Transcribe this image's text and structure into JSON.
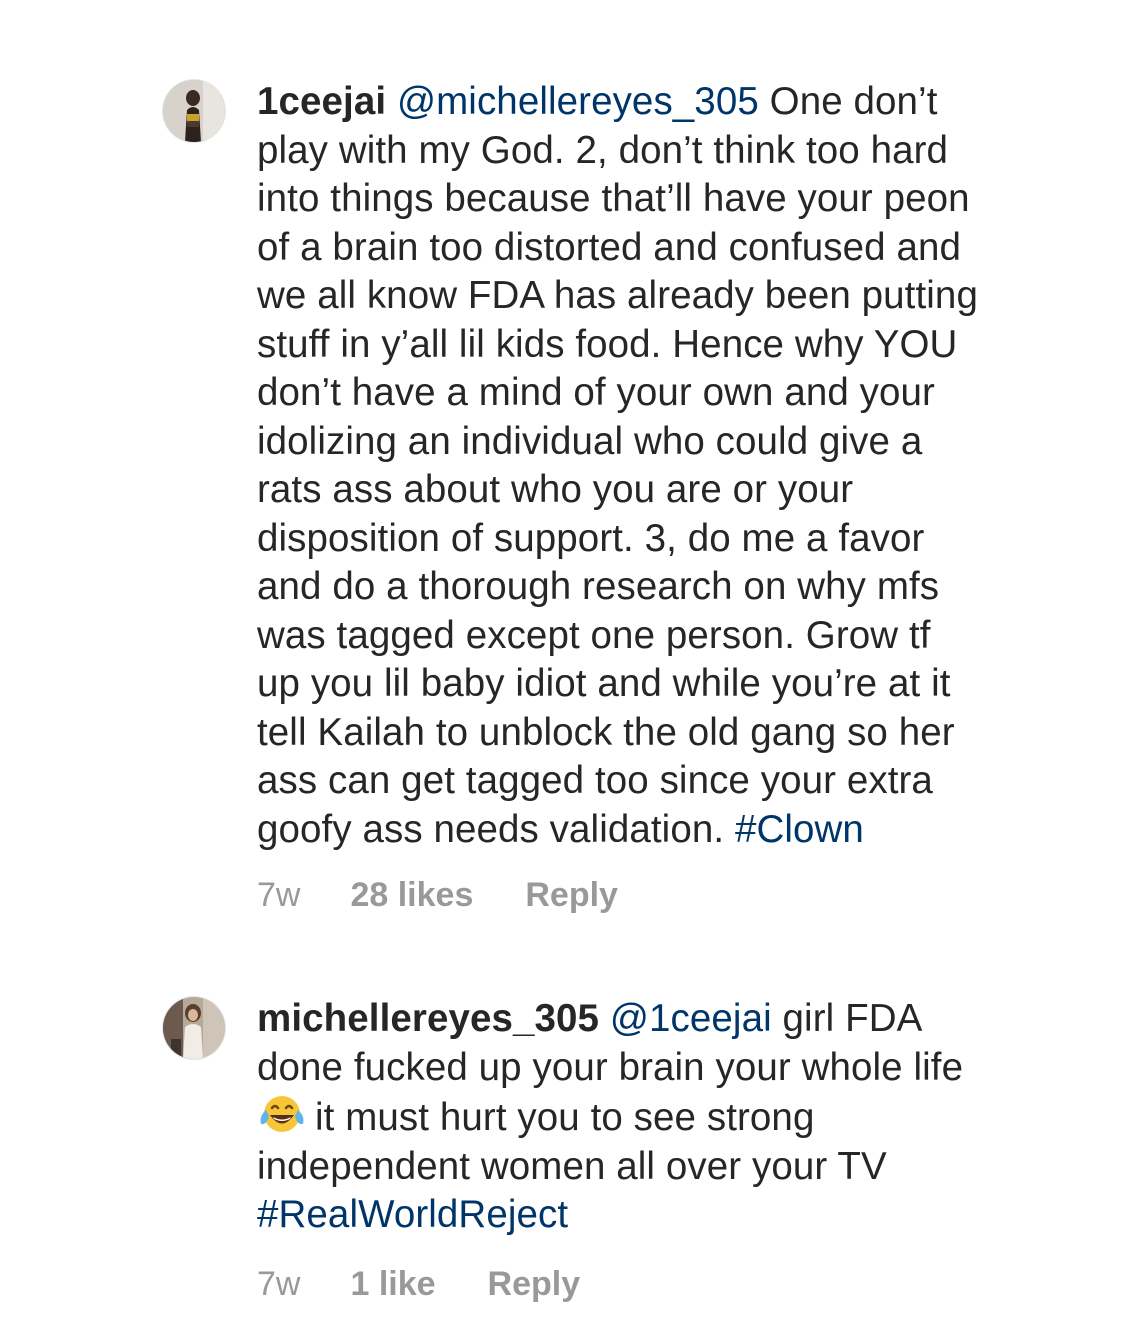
{
  "comments": [
    {
      "username": "1ceejai",
      "mention": "@michellereyes_305",
      "text_lines": [
        "One don’t",
        "play with my God. 2, don’t think too hard",
        "into things because that’ll have your peon",
        "of a brain too distorted and confused and",
        "we all know FDA has already been putting",
        "stuff in y’all lil kids food. Hence why YOU",
        "don’t have a mind of your own and your",
        "idolizing an individual who could give a",
        "rats ass about who you are or your",
        "disposition of support. 3, do me a favor",
        "and do a thorough research on why mfs",
        "was tagged except one person. Grow tf",
        "up you lil baby idiot and while you’re at it",
        "tell Kailah to unblock the old gang so her",
        "ass can get tagged too since your extra",
        "goofy ass needs validation."
      ],
      "hashtag": "#Clown",
      "time": "7w",
      "likes": "28 likes",
      "reply": "Reply"
    },
    {
      "username": "michellereyes_305",
      "mention": "@1ceejai",
      "text_line_1": "girl FDA",
      "text_line_2": "done fucked up your brain your whole life",
      "emoji": "face-with-tears-of-joy",
      "text_line_3": "it must hurt you to see strong",
      "text_line_4": "independent women all over your TV",
      "hashtag": "#RealWorldReject",
      "time": "7w",
      "likes": "1 like",
      "reply": "Reply"
    }
  ],
  "colors": {
    "text": "#262626",
    "link": "#003569",
    "meta": "#999999",
    "background": "#ffffff"
  }
}
